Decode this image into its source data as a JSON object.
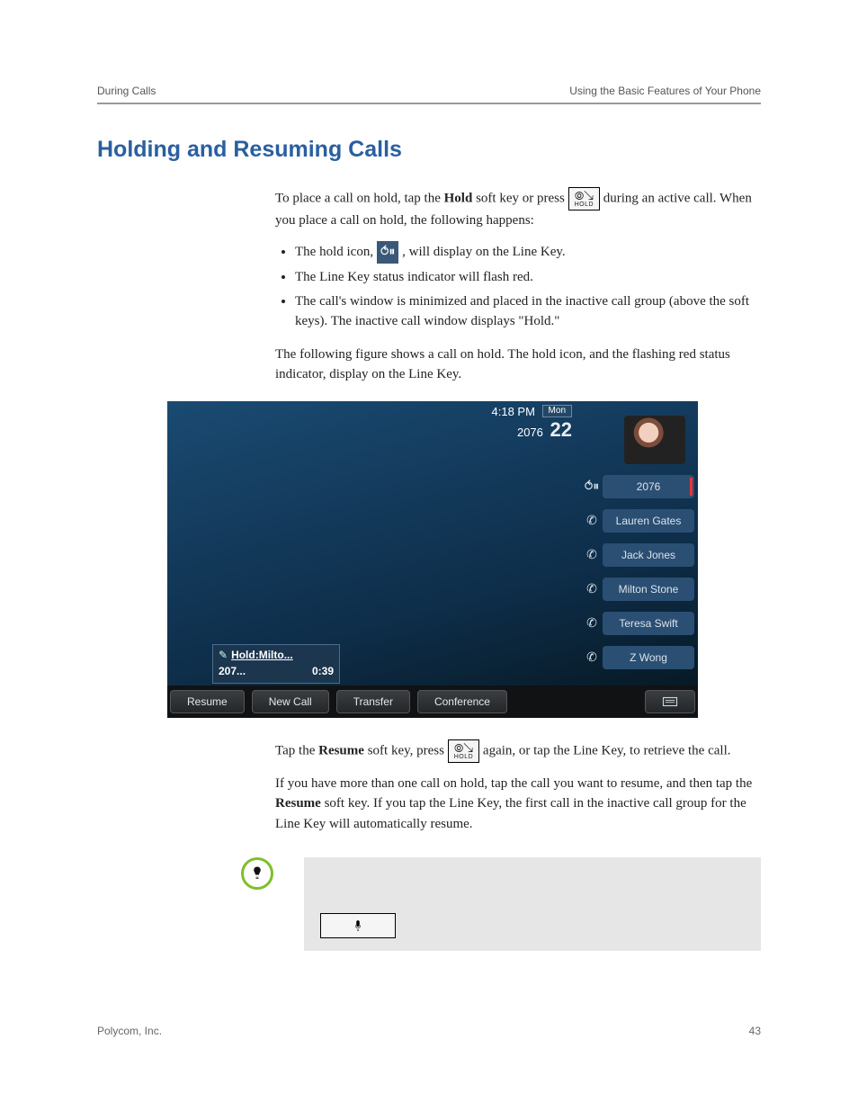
{
  "header": {
    "left": "During Calls",
    "right": "Using the Basic Features of Your Phone"
  },
  "title": "Holding and Resuming Calls",
  "p1_a": "To place a call on hold, tap the ",
  "p1_hold": "Hold",
  "p1_b": " soft key or press ",
  "hold_btn_label": "HOLD",
  "p1_c": " during an active call. When you place a call on hold, the following happens:",
  "bullets": {
    "b1_a": "The hold icon, ",
    "b1_b": ", will display on the Line Key.",
    "b2": "The Line Key status indicator will flash red.",
    "b3": "The call's window is minimized and placed in the inactive call group (above the soft keys). The inactive call window displays \"Hold.\""
  },
  "p2": "The following figure shows a call on hold. The hold icon, and the flashing red status indicator, display on the Line Key.",
  "phone": {
    "time": "4:18 PM",
    "day": "Mon",
    "date": "22",
    "ext": "2076",
    "line0": "2076",
    "line1": "Lauren Gates",
    "line2": "Jack Jones",
    "line3": "Milton Stone",
    "line4": "Teresa Swift",
    "line5": "Z Wong",
    "holdcard": {
      "title": "Hold:Milto...",
      "num": "207...",
      "dur": "0:39"
    },
    "soft": {
      "k1": "Resume",
      "k2": "New Call",
      "k3": "Transfer",
      "k4": "Conference"
    }
  },
  "p3_a": "Tap the ",
  "p3_resume": "Resume",
  "p3_b": " soft key, press ",
  "p3_c": " again, or tap the Line Key, to retrieve the call.",
  "p4_a": "If you have more than one call on hold, tap the call you want to resume, and then tap the ",
  "p4_resume": "Resume",
  "p4_b": " soft key. If you tap the Line Key, the first call in the inactive call group for the Line Key will automatically resume.",
  "footer": {
    "left": "Polycom, Inc.",
    "right": "43"
  }
}
